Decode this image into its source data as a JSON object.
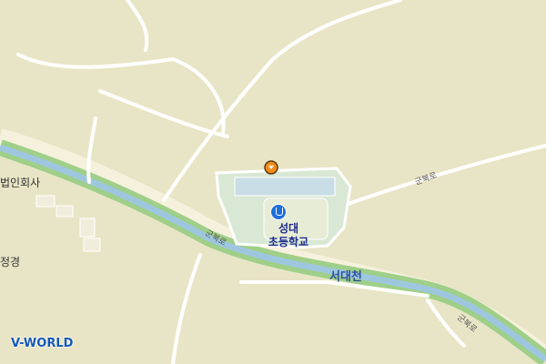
{
  "map": {
    "labels": {
      "school_line1": "성대",
      "school_line2": "초등학교",
      "river": "서대천",
      "road_1": "군북로",
      "road_2": "군북로",
      "road_3": "군북로",
      "left_1": "법인회사",
      "left_2": "정경"
    },
    "icons": {
      "school": "school-icon",
      "pin": "location-pin-icon"
    },
    "logo": "V-WORLD"
  },
  "colors": {
    "background": "#e8e5c6",
    "river_bank": "#9fcf88",
    "river_water": "#9ec7df",
    "road": "#ffffff",
    "road_major": "#f5f1dc",
    "school_area": "#d8e8d4",
    "pin": "#f28b1c"
  }
}
